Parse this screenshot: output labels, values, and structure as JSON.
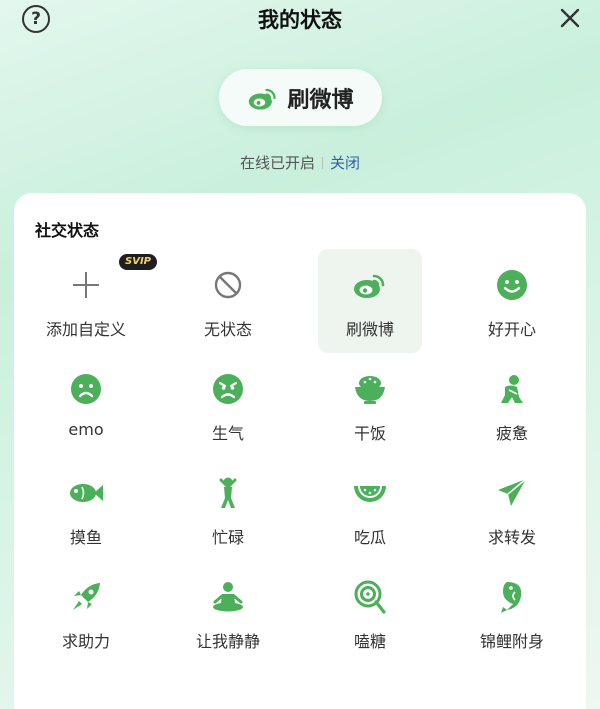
{
  "header": {
    "title": "我的状态",
    "help_glyph": "?",
    "close_icon": "close-icon",
    "help_icon": "question-circle-icon"
  },
  "current_status": {
    "label": "刷微博",
    "icon": "weibo-icon"
  },
  "online": {
    "text": "在线已开启",
    "action": "关闭"
  },
  "panel": {
    "title": "社交状态"
  },
  "badge": {
    "text": "SVIP"
  },
  "colors": {
    "accent": "#4caf5a",
    "link": "#2f5fa8"
  },
  "statuses": [
    {
      "label": "添加自定义",
      "icon": "plus-icon"
    },
    {
      "label": "无状态",
      "icon": "no-status-icon"
    },
    {
      "label": "刷微博",
      "icon": "weibo-icon",
      "selected": true
    },
    {
      "label": "好开心",
      "icon": "happy-face-icon"
    },
    {
      "label": "emo",
      "icon": "sad-face-icon"
    },
    {
      "label": "生气",
      "icon": "angry-face-icon"
    },
    {
      "label": "干饭",
      "icon": "rice-bowl-icon"
    },
    {
      "label": "疲惫",
      "icon": "tired-person-icon"
    },
    {
      "label": "摸鱼",
      "icon": "fish-icon"
    },
    {
      "label": "忙碌",
      "icon": "busy-person-icon"
    },
    {
      "label": "吃瓜",
      "icon": "watermelon-icon"
    },
    {
      "label": "求转发",
      "icon": "paper-plane-icon"
    },
    {
      "label": "求助力",
      "icon": "rocket-icon"
    },
    {
      "label": "让我静静",
      "icon": "meditation-icon"
    },
    {
      "label": "嗑糖",
      "icon": "lollipop-icon"
    },
    {
      "label": "锦鲤附身",
      "icon": "koi-icon"
    }
  ]
}
